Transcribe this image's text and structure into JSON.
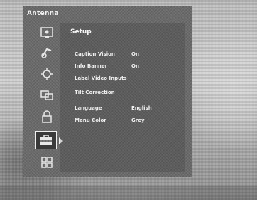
{
  "app_title": "Antenna",
  "rail": {
    "items": [
      {
        "icon": "tv-screen-icon"
      },
      {
        "icon": "sound-icon"
      },
      {
        "icon": "channel-scan-icon"
      },
      {
        "icon": "picture-adjust-icon"
      },
      {
        "icon": "parental-lock-icon"
      },
      {
        "icon": "setup-toolbox-icon",
        "selected": true
      },
      {
        "icon": "grid-icon"
      }
    ]
  },
  "panel": {
    "title": "Setup",
    "rows": [
      {
        "label": "Caption Vision",
        "value": "On"
      },
      {
        "label": "Info Banner",
        "value": "On"
      },
      {
        "label": "Label Video Inputs",
        "value": ""
      },
      {
        "label": "Tilt Correction",
        "value": ""
      },
      {
        "label": "Language",
        "value": "English"
      },
      {
        "label": "Menu Color",
        "value": "Grey"
      }
    ]
  }
}
